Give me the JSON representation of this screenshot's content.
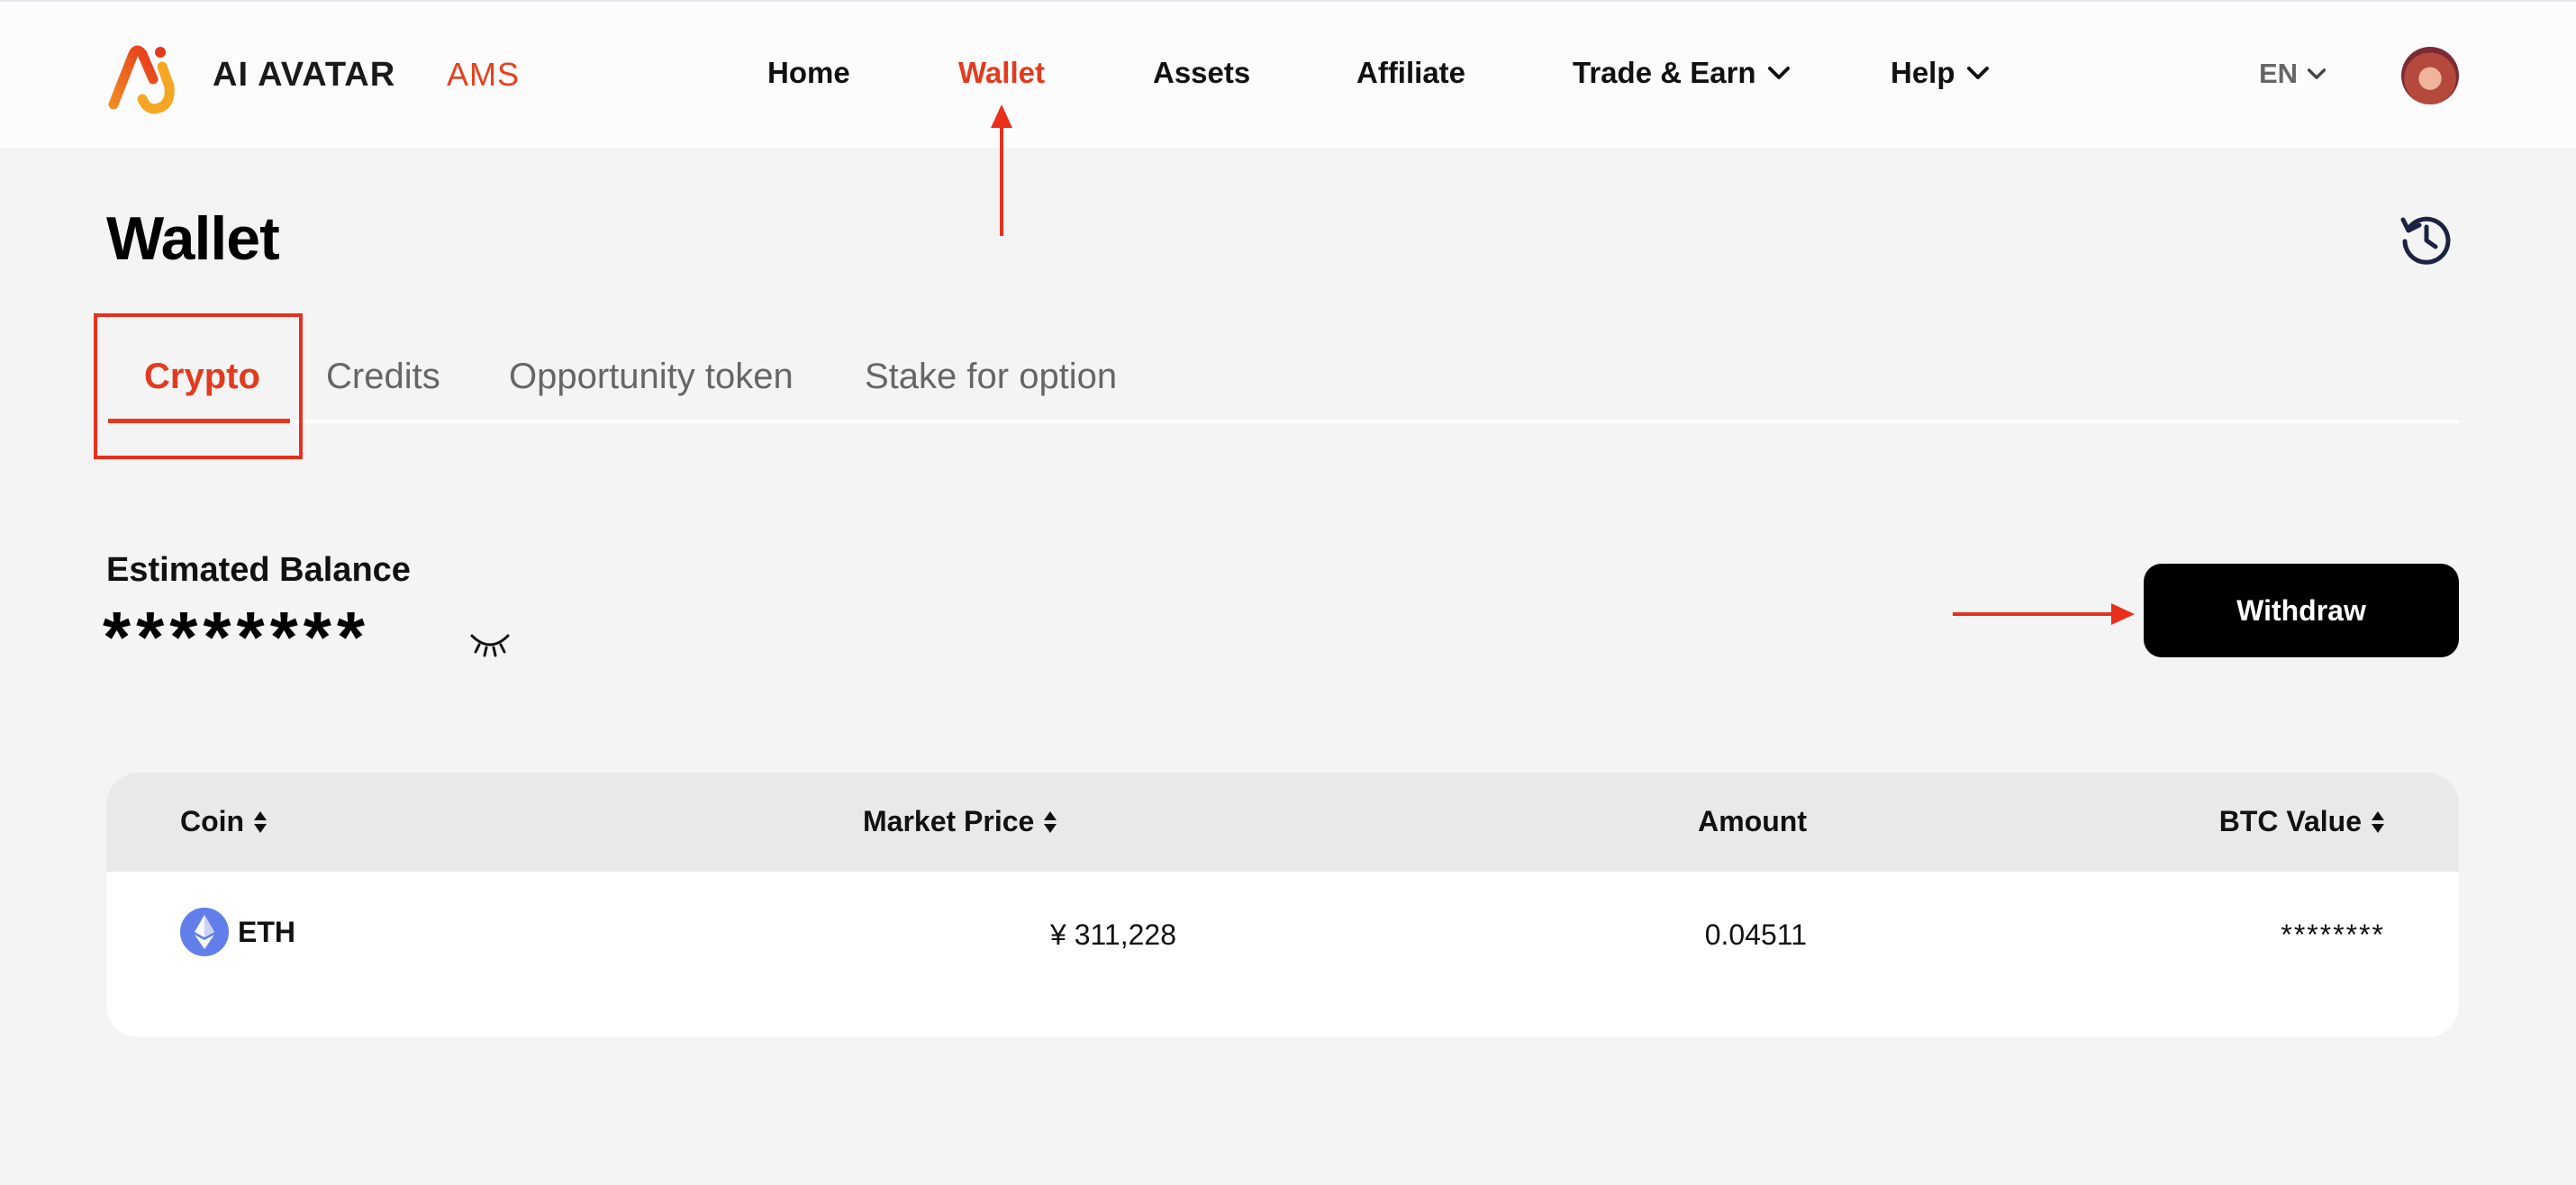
{
  "header": {
    "brand_name": "AI AVATAR",
    "brand_sub": "AMS",
    "nav": [
      {
        "label": "Home"
      },
      {
        "label": "Wallet"
      },
      {
        "label": "Assets"
      },
      {
        "label": "Affiliate"
      },
      {
        "label": "Trade & Earn"
      },
      {
        "label": "Help"
      }
    ],
    "language": "EN"
  },
  "page": {
    "title": "Wallet",
    "tabs": [
      {
        "label": "Crypto"
      },
      {
        "label": "Credits"
      },
      {
        "label": "Opportunity token"
      },
      {
        "label": "Stake for option"
      }
    ]
  },
  "balance": {
    "label": "Estimated Balance",
    "value": "********",
    "withdraw_label": "Withdraw"
  },
  "table": {
    "columns": [
      "Coin",
      "Market Price",
      "Amount",
      "BTC Value"
    ],
    "rows": [
      {
        "coin": "ETH",
        "market_price": "¥ 311,228",
        "amount": "0.04511",
        "btc_value": "********"
      }
    ]
  },
  "colors": {
    "accent": "#e33a1d",
    "annotation": "#e8301c",
    "button_bg": "#000000",
    "eth": "#627eea"
  },
  "icons": [
    "logo-icon",
    "chevron-down-icon",
    "history-icon",
    "eye-closed-icon",
    "sort-icon",
    "eth-icon",
    "avatar"
  ]
}
